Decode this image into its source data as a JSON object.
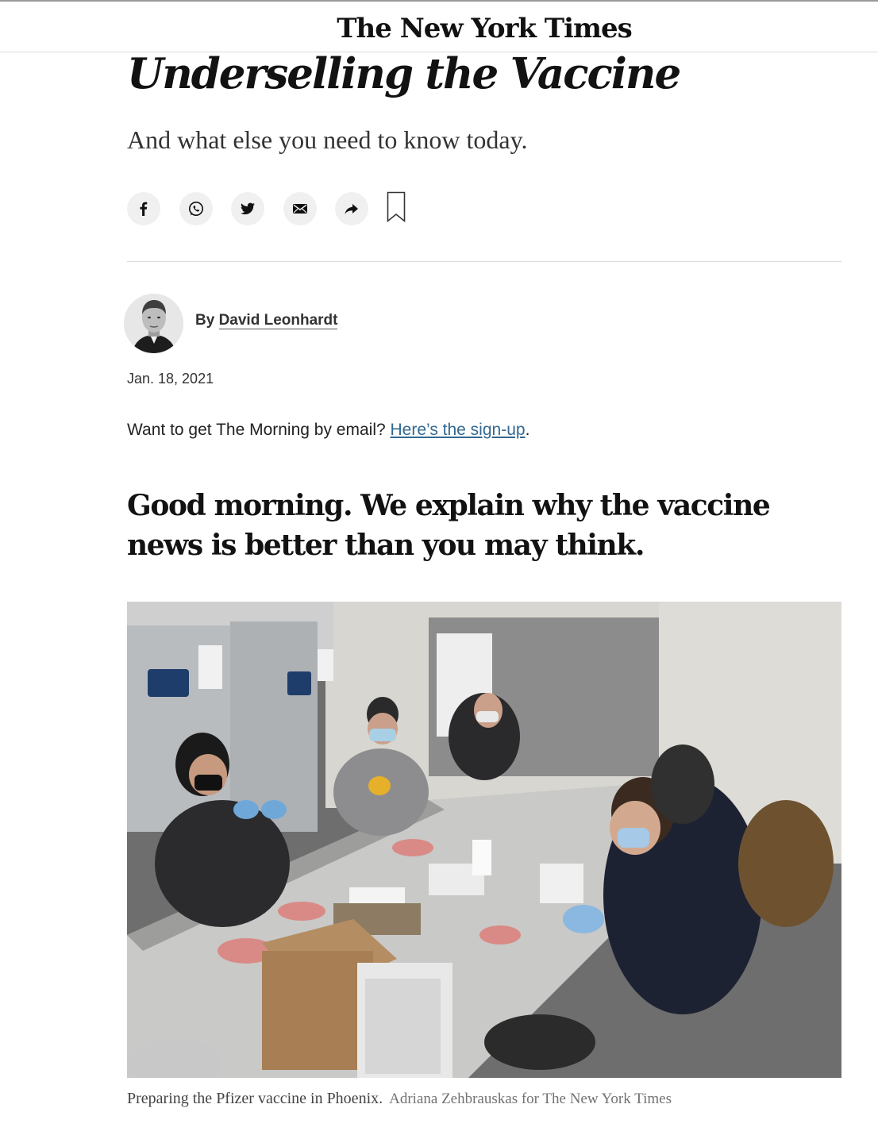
{
  "header": {
    "masthead": "The New York Times"
  },
  "article": {
    "headline": "Underselling the Vaccine",
    "dek": "And what else you need to know today.",
    "byline_prefix": "By",
    "author": "David Leonhardt",
    "date": "Jan. 18, 2021",
    "signup_text": "Want to get The Morning by email?",
    "signup_link": "Here’s the sign-up",
    "signup_end": ".",
    "lead_paragraph": "Good morning. We explain why the vaccine news is better than you may think."
  },
  "share_icons": [
    "facebook-icon",
    "whatsapp-icon",
    "twitter-icon",
    "email-icon",
    "share-arrow-icon",
    "bookmark-icon"
  ],
  "photo": {
    "caption": "Preparing the Pfizer vaccine in Phoenix.",
    "credit": "Adriana Zehbrauskas for The New York Times"
  },
  "colors": {
    "link": "#326891",
    "text": "#121212",
    "icon_bg": "#f0f0f0"
  }
}
